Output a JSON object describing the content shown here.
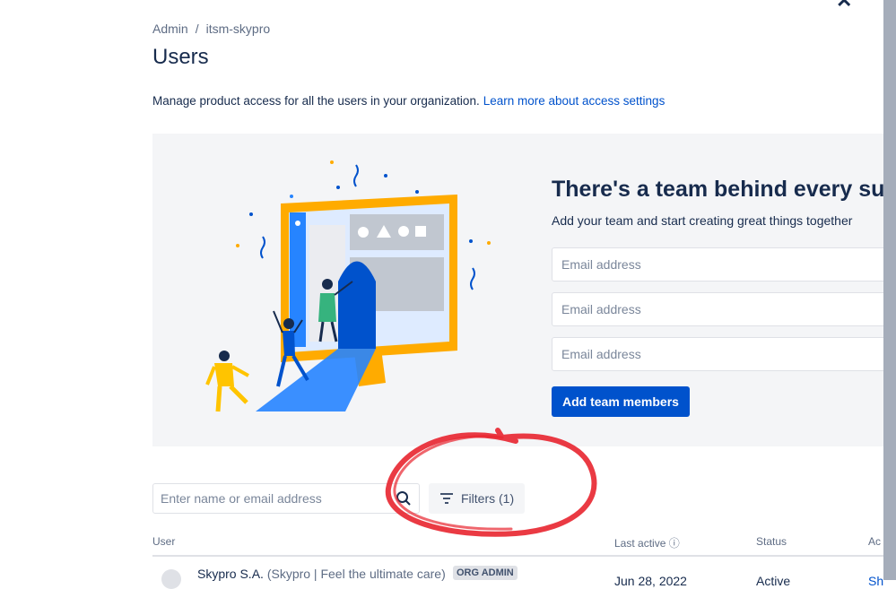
{
  "breadcrumb": {
    "items": [
      "Admin",
      "itsm-skypro"
    ],
    "separator": "/"
  },
  "page": {
    "title": "Users",
    "description": "Manage product access for all the users in your organization.",
    "description_link": "Learn more about access settings"
  },
  "promo": {
    "title": "There's a team behind every succe",
    "subtitle": "Add your team and start creating great things together",
    "email_placeholder": "Email address",
    "add_button": "Add team members"
  },
  "toolbar": {
    "search_placeholder": "Enter name or email address",
    "filters_label": "Filters (1)"
  },
  "table": {
    "columns": [
      "User",
      "Last active",
      "Status",
      "Ac"
    ],
    "rows": [
      {
        "name": "Skypro S.A.",
        "detail": "(Skypro | Feel the ultimate care)",
        "badge": "ORG ADMIN",
        "last_active": "Jun 28, 2022",
        "status": "Active",
        "action": "Sh"
      }
    ]
  },
  "colors": {
    "brand": "#0052cc",
    "annotation": "#e8252f",
    "panel": "#f4f5f7"
  }
}
